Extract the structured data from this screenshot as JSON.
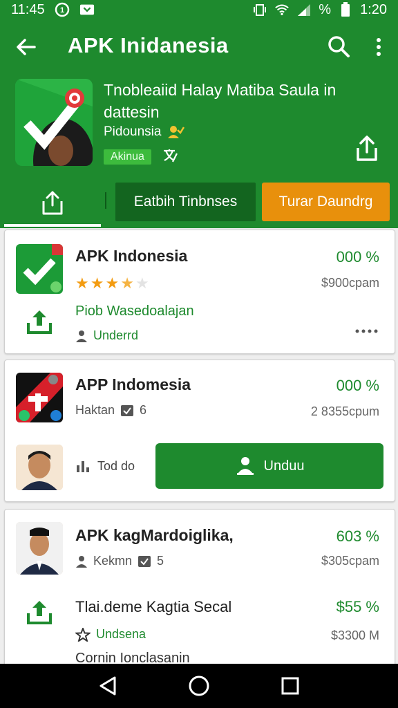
{
  "status_bar": {
    "time_left": "11:45",
    "battery_pct": "%",
    "time_right": "1:20"
  },
  "toolbar": {
    "title": "APK Inidanesia"
  },
  "hero": {
    "title": "Tnobleaiid Halay Matiba Saula in dattesin",
    "publisher": "Pidounsia",
    "badge": "Akinua"
  },
  "tabs": {
    "tab1_label": "Eatbih Tinbnses",
    "tab2_label": "Turar Daundrg"
  },
  "cards": [
    {
      "name": "APK Indonesia",
      "percent": "000 %",
      "price": "$900cpam",
      "rating_stars": 3.5,
      "description": "Piob Wasedoalajan",
      "author": "Underrd"
    },
    {
      "name": "APP Indomesia",
      "percent": "000 %",
      "meta_label": "Haktan",
      "meta_count": "6",
      "price": "2 8355cpum",
      "secondary_label": "Tod do",
      "download_label": "Unduu"
    },
    {
      "name": "APK kagMardoiglika,",
      "percent": "603 %",
      "meta_label": "Kekmn",
      "meta_count": "5",
      "price": "$305cpam",
      "row2_title": "Tlai.deme Kagtia Secal",
      "row2_percent": "$55 %",
      "row2_author": "Undsena",
      "row2_price": "$3300 M",
      "row3_partial": "Cornin Ionclasanin"
    }
  ],
  "colors": {
    "primary_green": "#1e8a2e",
    "dark_green": "#13651f",
    "orange": "#e8900c"
  }
}
